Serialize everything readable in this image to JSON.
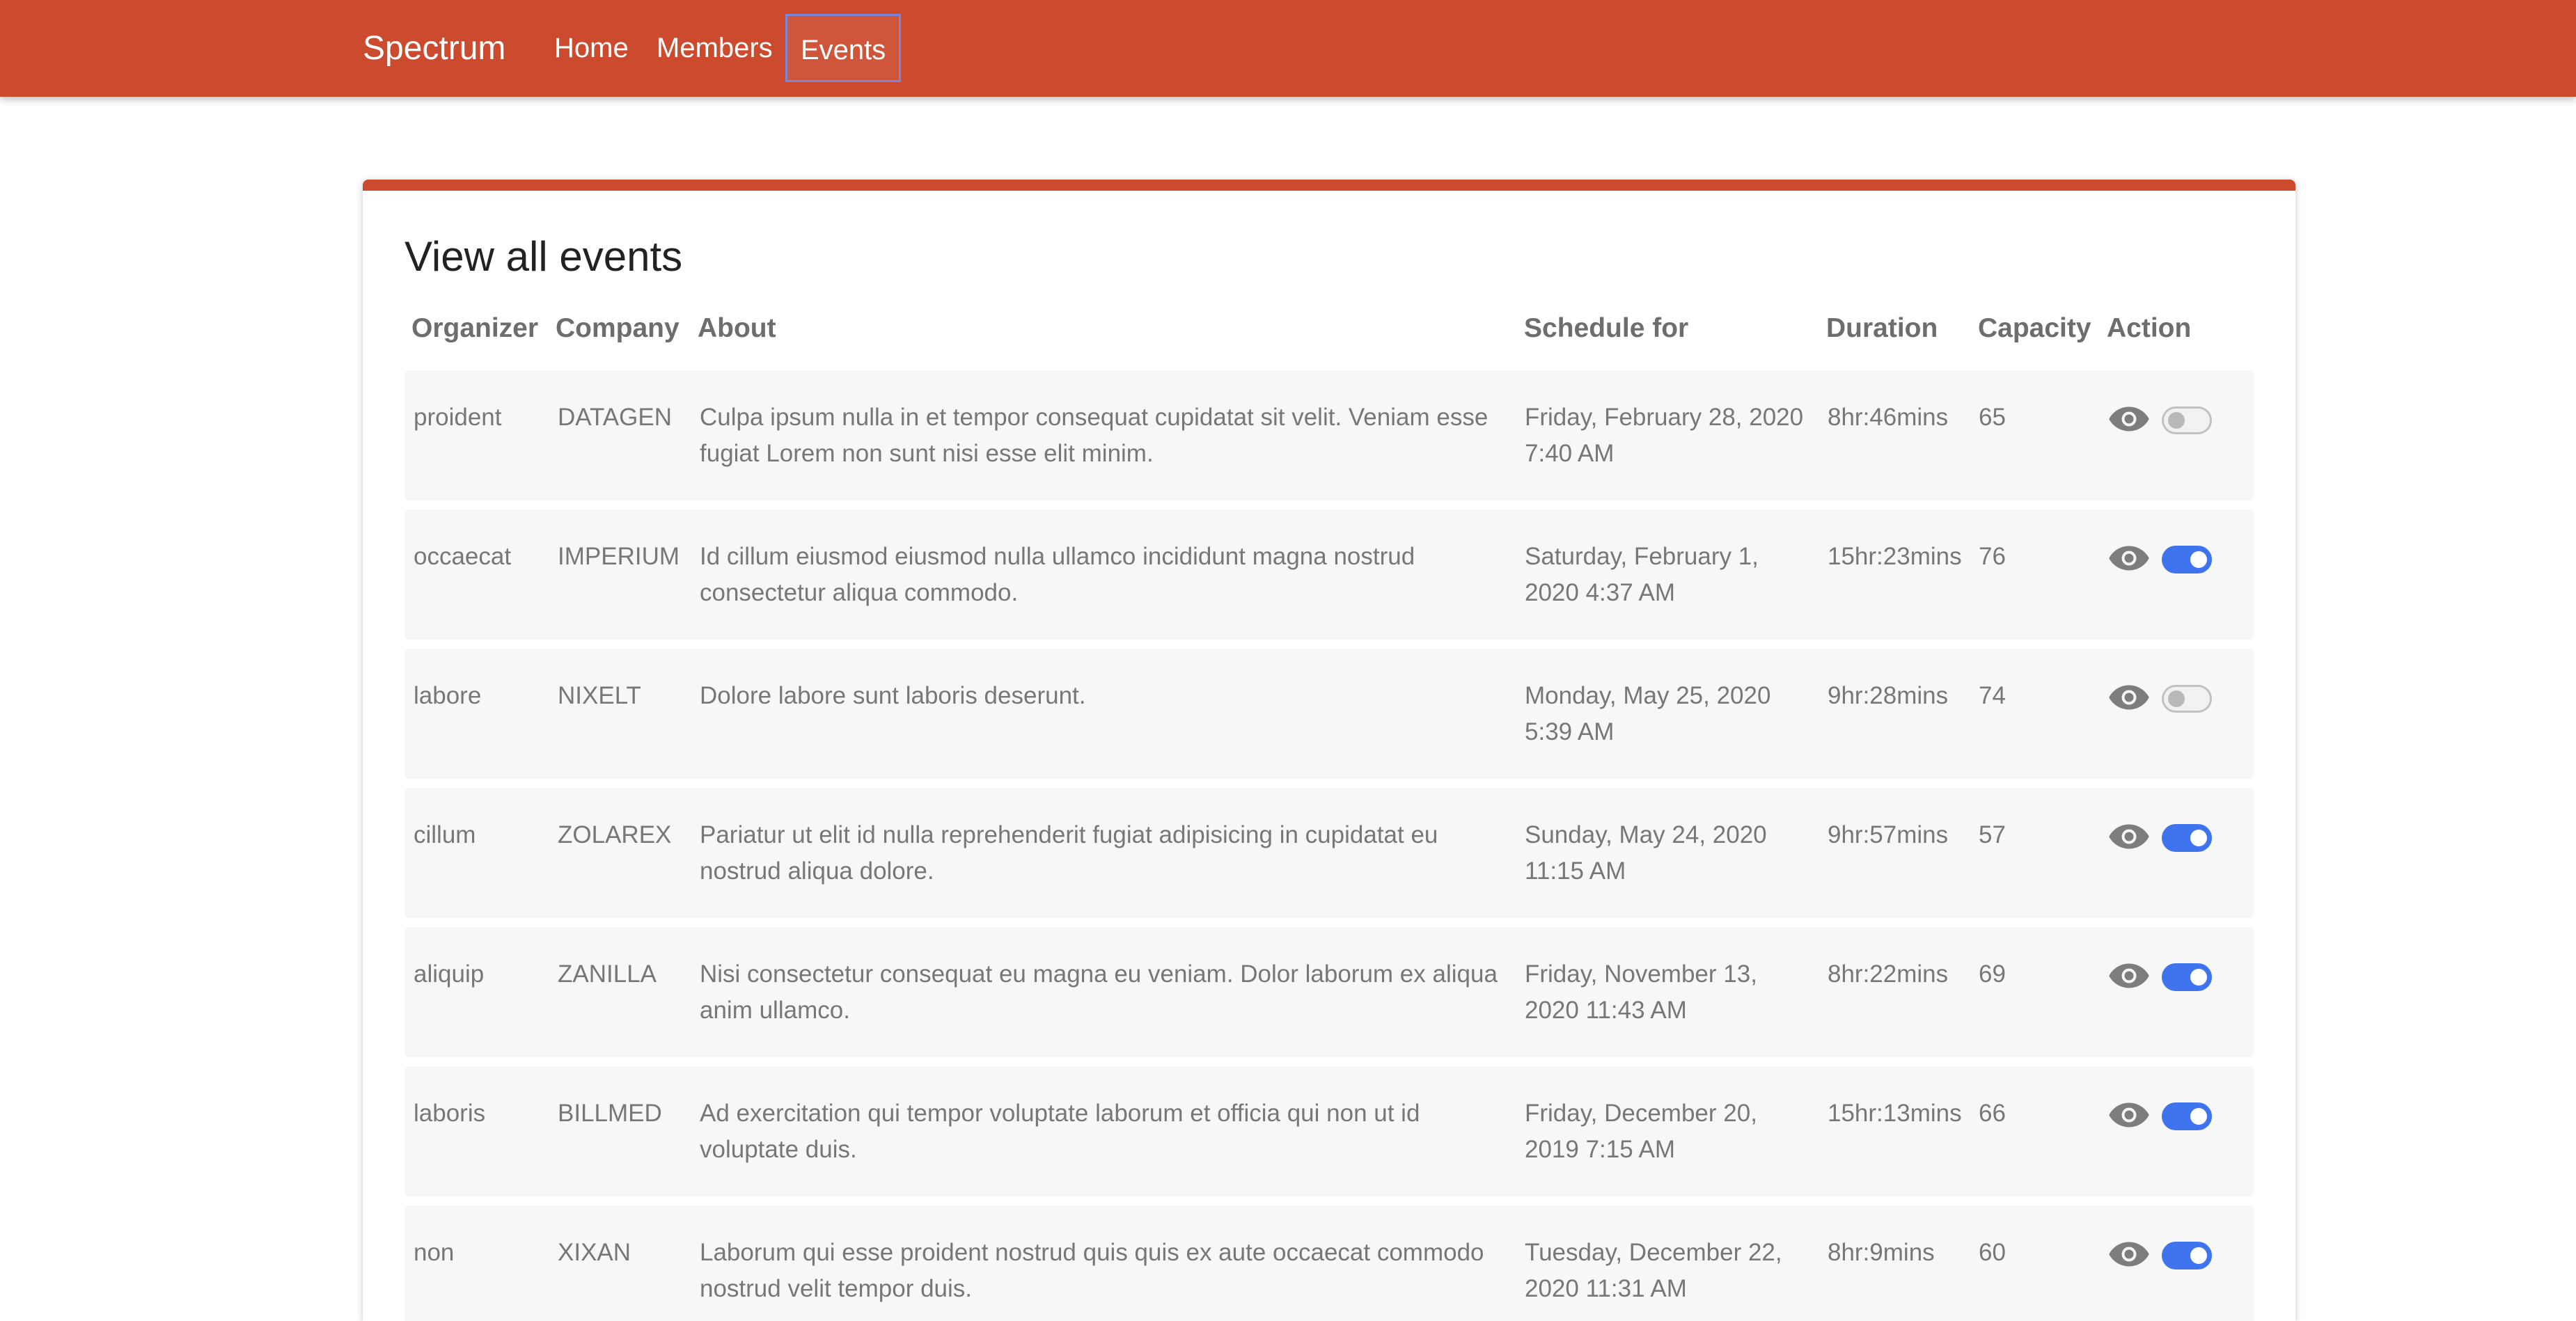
{
  "nav": {
    "brand": "Spectrum",
    "links": [
      "Home",
      "Members",
      "Events"
    ],
    "active": "Events"
  },
  "page": {
    "title": "View all events"
  },
  "table": {
    "headers": [
      "Organizer",
      "Company",
      "About",
      "Schedule for",
      "Duration",
      "Capacity",
      "Action"
    ],
    "rows": [
      {
        "organizer": "proident",
        "company": "DATAGEN",
        "about": "Culpa ipsum nulla in et tempor consequat cupidatat sit velit. Veniam esse fugiat Lorem non sunt nisi esse elit minim.",
        "schedule": "Friday, February 28, 2020 7:40 AM",
        "duration": "8hr:46mins",
        "capacity": "65",
        "enabled": false
      },
      {
        "organizer": "occaecat",
        "company": "IMPERIUM",
        "about": "Id cillum eiusmod eiusmod nulla ullamco incididunt magna nostrud consectetur aliqua commodo.",
        "schedule": "Saturday, February 1, 2020 4:37 AM",
        "duration": "15hr:23mins",
        "capacity": "76",
        "enabled": true
      },
      {
        "organizer": "labore",
        "company": "NIXELT",
        "about": "Dolore labore sunt laboris deserunt.",
        "schedule": "Monday, May 25, 2020 5:39 AM",
        "duration": "9hr:28mins",
        "capacity": "74",
        "enabled": false
      },
      {
        "organizer": "cillum",
        "company": "ZOLAREX",
        "about": "Pariatur ut elit id nulla reprehenderit fugiat adipisicing in cupidatat eu nostrud aliqua dolore.",
        "schedule": "Sunday, May 24, 2020 11:15 AM",
        "duration": "9hr:57mins",
        "capacity": "57",
        "enabled": true
      },
      {
        "organizer": "aliquip",
        "company": "ZANILLA",
        "about": "Nisi consectetur consequat eu magna eu veniam. Dolor laborum ex aliqua anim ullamco.",
        "schedule": "Friday, November 13, 2020 11:43 AM",
        "duration": "8hr:22mins",
        "capacity": "69",
        "enabled": true
      },
      {
        "organizer": "laboris",
        "company": "BILLMED",
        "about": "Ad exercitation qui tempor voluptate laborum et officia qui non ut id voluptate duis.",
        "schedule": "Friday, December 20, 2019 7:15 AM",
        "duration": "15hr:13mins",
        "capacity": "66",
        "enabled": true
      },
      {
        "organizer": "non",
        "company": "XIXAN",
        "about": "Laborum qui esse proident nostrud quis quis ex aute occaecat commodo nostrud velit tempor duis.",
        "schedule": "Tuesday, December 22, 2020 11:31 AM",
        "duration": "8hr:9mins",
        "capacity": "60",
        "enabled": true
      }
    ]
  },
  "colors": {
    "brand": "#cc4a2d",
    "toggle_on": "#3f74ee",
    "toggle_off": "#c2c2c2",
    "row_bg": "#f7f7f7"
  },
  "icons": {
    "view": "eye-icon"
  }
}
